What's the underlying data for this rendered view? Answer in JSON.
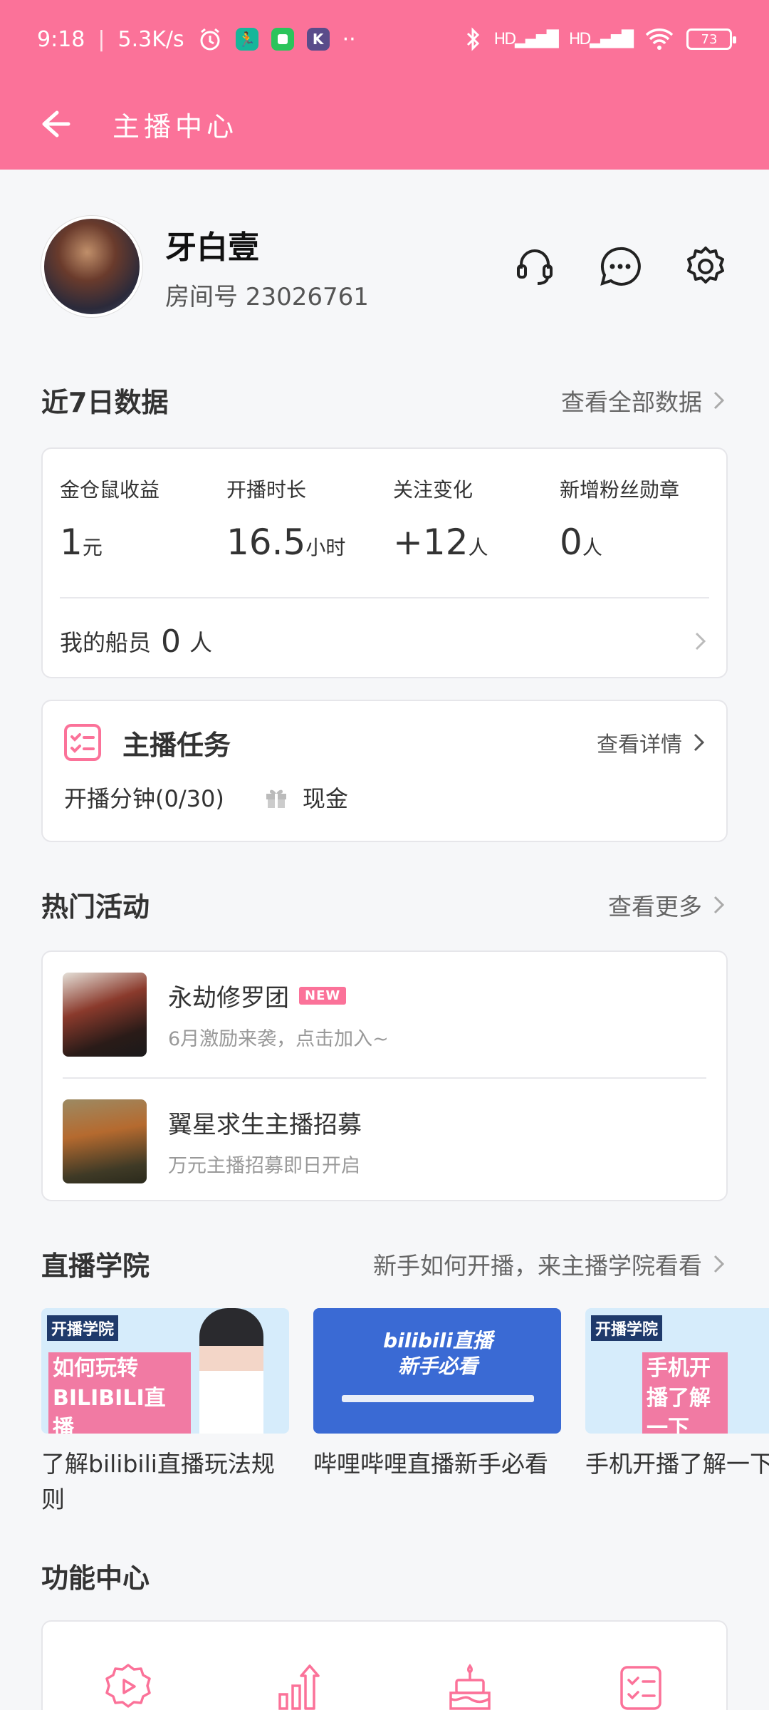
{
  "status_bar": {
    "time": "9:18",
    "speed": "5.3K/s",
    "battery": "73"
  },
  "nav": {
    "title": "主播中心"
  },
  "profile": {
    "name": "牙白壹",
    "room_number": "房间号 23026761"
  },
  "recent_data": {
    "title": "近7日数据",
    "link": "查看全部数据",
    "stats": [
      {
        "label": "金仓鼠收益",
        "value": "1",
        "unit": "元"
      },
      {
        "label": "开播时长",
        "value": "16.5",
        "unit": "小时"
      },
      {
        "label": "关注变化",
        "value": "+12",
        "unit": "人"
      },
      {
        "label": "新增粉丝勋章",
        "value": "0",
        "unit": "人"
      }
    ],
    "crew": {
      "label": "我的船员",
      "value": "0",
      "unit": "人"
    }
  },
  "tasks": {
    "title": "主播任务",
    "link": "查看详情",
    "progress": "开播分钟(0/30)",
    "reward": "现金"
  },
  "activities": {
    "title": "热门活动",
    "link": "查看更多",
    "items": [
      {
        "title": "永劫修罗团",
        "badge": "NEW",
        "subtitle": "6月激励来袭，点击加入~"
      },
      {
        "title": "翼星求生主播招募",
        "badge": "",
        "subtitle": "万元主播招募即日开启"
      }
    ]
  },
  "academy": {
    "title": "直播学院",
    "link": "新手如何开播，来主播学院看看",
    "courses": [
      {
        "title": "了解bilibili直播玩法规则",
        "image_text": "如何玩转BILIBILI直播",
        "image_tag": "开播学院"
      },
      {
        "title": "哔哩哔哩直播新手必看",
        "image_text": "bilibili直播 新手必看",
        "image_tag": ""
      },
      {
        "title": "手机开播了解一下",
        "image_text": "手机开播了解一下",
        "image_tag": "开播学院"
      }
    ]
  },
  "functions": {
    "title": "功能中心"
  },
  "colors": {
    "brand": "#fb7299",
    "background": "#f6f7f9",
    "academy_card": "#d6ecfb",
    "academy_blue": "#3a6ad4"
  }
}
